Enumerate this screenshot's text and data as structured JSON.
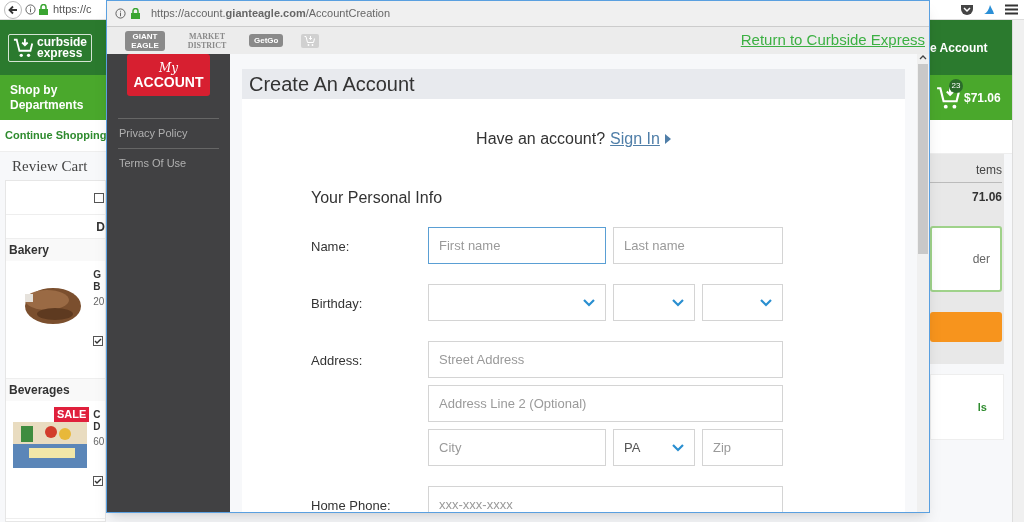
{
  "background_page": {
    "url_fragment": "https://c",
    "logo": [
      "curbside",
      "express"
    ],
    "nav_button": "Shop by Departments",
    "continue_link": "Continue Shopping",
    "page_title": "Review Cart",
    "select_all_checked": false,
    "column_fragment": "D",
    "sections": [
      {
        "name": "Bakery",
        "product_fragments": [
          "G",
          "B",
          "20"
        ],
        "checked": true
      },
      {
        "name": "Beverages",
        "badge": "SALE",
        "product_fragments": [
          "C",
          "D",
          "60"
        ],
        "checked": true
      }
    ],
    "account_fragment": "e Account",
    "cart_count": "23",
    "cart_total": "$71.06",
    "summary_items_fragment": "tems",
    "summary_total_fragment": "71.06",
    "order_box_fragment": "der",
    "link_fragment": "ls"
  },
  "popup": {
    "url": "https://account.**gianteagle.com**/AccountCreation",
    "brand_logos": [
      "GIANT EAGLE",
      "MARKET DISTRICT",
      "GetGo"
    ],
    "return_link": "Return to Curbside Express",
    "sidebar": {
      "logo_script": "My",
      "logo_text": "ACCOUNT",
      "links": [
        "Privacy Policy",
        "Terms Of Use"
      ]
    },
    "title": "Create An Account",
    "signin_prompt": "Have an account?",
    "signin_link": "Sign In",
    "section_title": "Your Personal Info",
    "rows": [
      {
        "label": "Name:",
        "lines": [
          [
            {
              "kind": "text",
              "placeholder": "First name",
              "focused": true
            },
            {
              "kind": "text",
              "placeholder": "Last name",
              "focused": false
            }
          ]
        ]
      },
      {
        "label": "Birthday:",
        "lines": [
          [
            {
              "kind": "select",
              "focused": false
            },
            {
              "kind": "select",
              "focused": false
            },
            {
              "kind": "select",
              "focused": false
            }
          ]
        ]
      },
      {
        "label": "Address:",
        "lines": [
          [
            {
              "kind": "text",
              "placeholder": "Street Address",
              "focused": false
            }
          ],
          [
            {
              "kind": "text",
              "placeholder": "Address Line 2 (Optional)",
              "focused": false
            }
          ],
          [
            {
              "kind": "text",
              "placeholder": "City",
              "focused": false
            },
            {
              "kind": "select",
              "value": "PA",
              "focused": false
            },
            {
              "kind": "text",
              "placeholder": "Zip",
              "focused": false
            }
          ]
        ]
      },
      {
        "label": "Home Phone:",
        "lines": [
          [
            {
              "kind": "text",
              "placeholder": "xxx-xxx-xxxx",
              "focused": false
            }
          ]
        ]
      }
    ]
  }
}
